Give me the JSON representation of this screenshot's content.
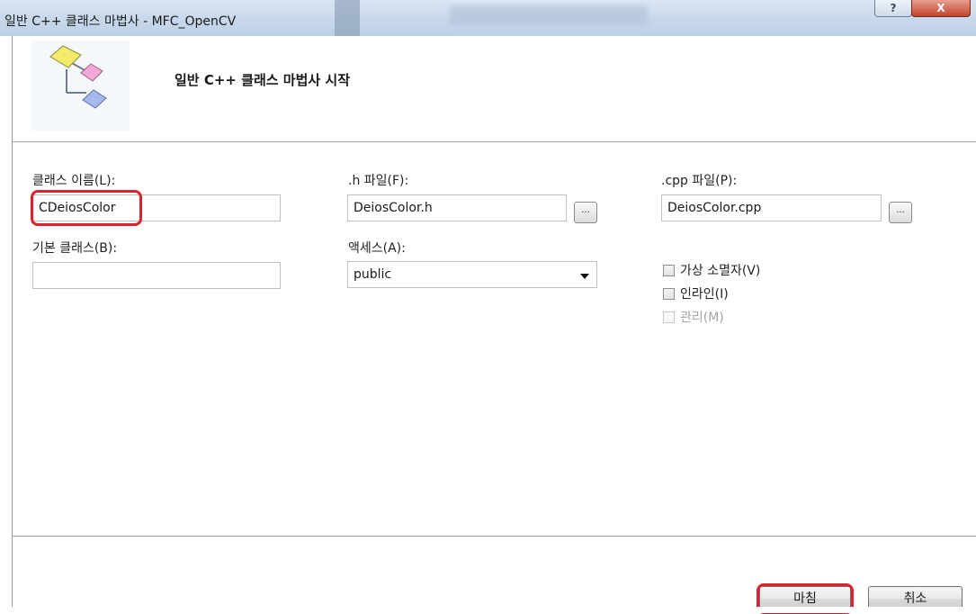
{
  "window": {
    "title": "일반 C++ 클래스 마법사 - MFC_OpenCV"
  },
  "titlebar_buttons": {
    "help": "?",
    "close": "X"
  },
  "header": {
    "heading": "일반 C++ 클래스 마법사 시작"
  },
  "form": {
    "class_name_label": "클래스 이름(L):",
    "class_name_value": "CDeiosColor",
    "h_file_label": ".h 파일(F):",
    "h_file_value": "DeiosColor.h",
    "cpp_file_label": ".cpp 파일(P):",
    "cpp_file_value": "DeiosColor.cpp",
    "browse_label": "...",
    "base_class_label": "기본 클래스(B):",
    "base_class_value": "",
    "access_label": "액세스(A):",
    "access_value": "public",
    "checkboxes": [
      {
        "label": "가상 소멸자(V)",
        "checked": false,
        "enabled": true
      },
      {
        "label": "인라인(I)",
        "checked": false,
        "enabled": true
      },
      {
        "label": "관리(M)",
        "checked": false,
        "enabled": false
      }
    ]
  },
  "footer": {
    "finish_label": "마침",
    "cancel_label": "취소"
  },
  "colors": {
    "highlight": "#e0202a",
    "titlebar": "#c9d9ec",
    "close_button": "#c2432b"
  }
}
